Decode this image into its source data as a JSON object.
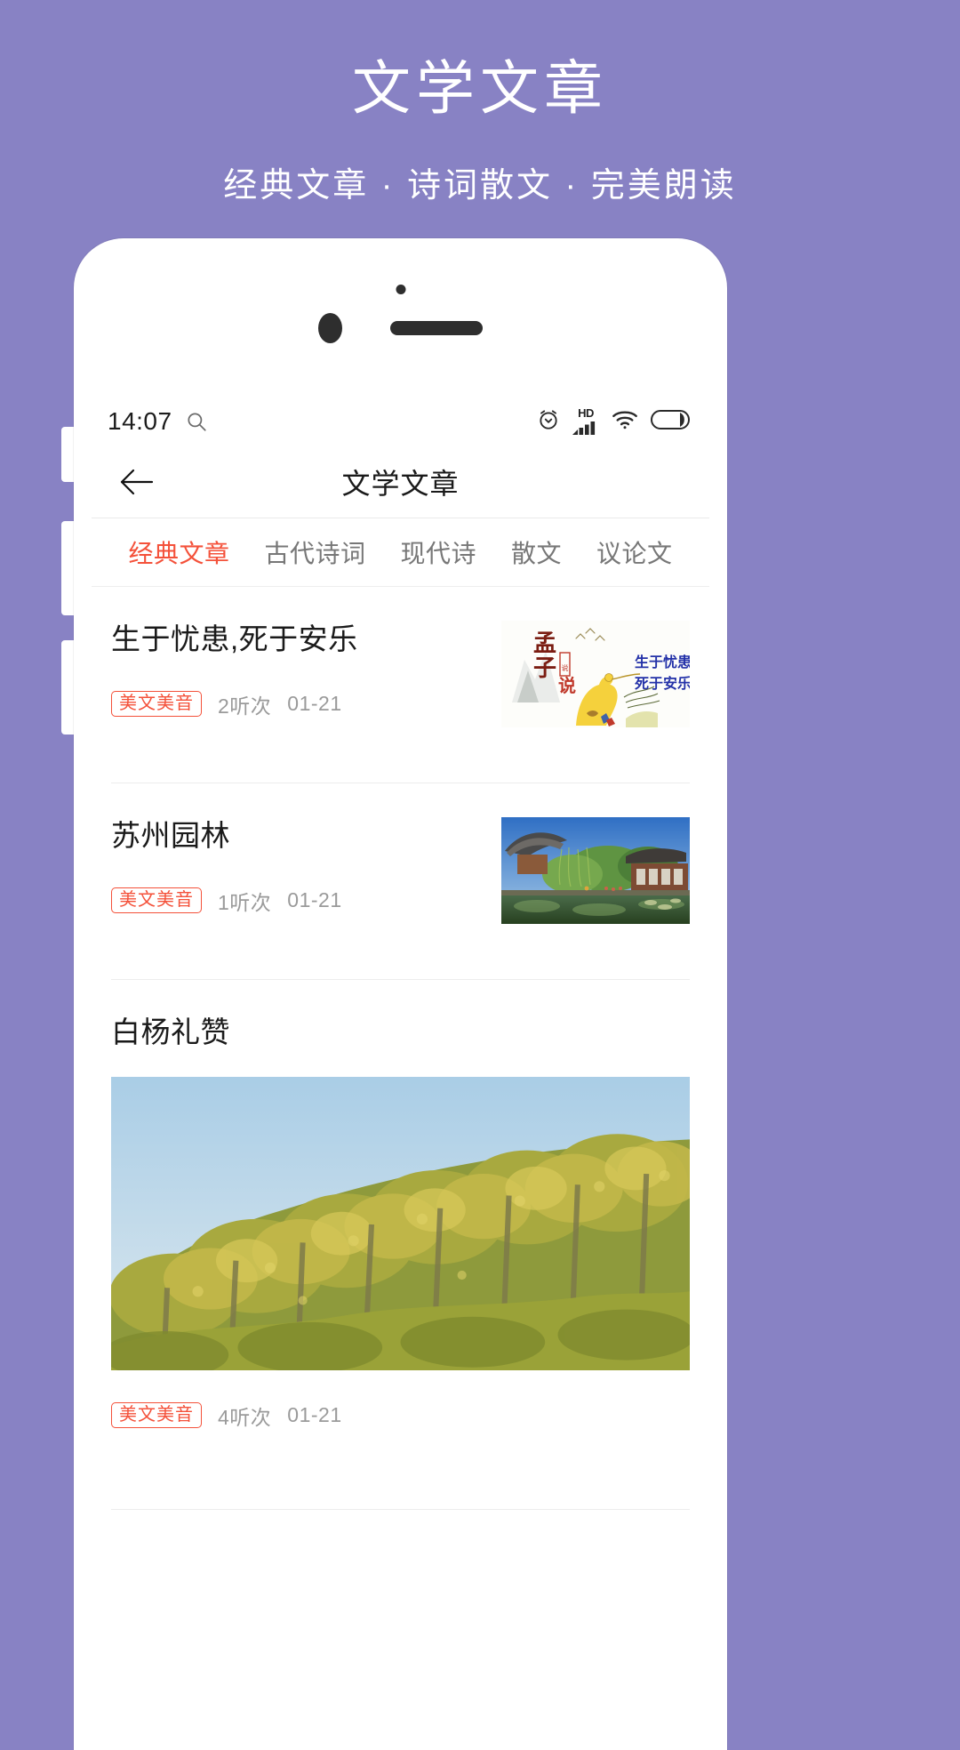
{
  "promo": {
    "title": "文学文章",
    "subtitle": "经典文章 · 诗词散文 · 完美朗读"
  },
  "statusbar": {
    "time": "14:07",
    "search_icon": "search-icon",
    "icons": [
      "alarm-icon",
      "hd-signal-icon",
      "wifi-icon",
      "battery-icon"
    ],
    "hd_label": "HD"
  },
  "navbar": {
    "back_icon": "back-arrow-icon",
    "title": "文学文章"
  },
  "tabs": [
    {
      "label": "经典文章",
      "active": true
    },
    {
      "label": "古代诗词",
      "active": false
    },
    {
      "label": "现代诗",
      "active": false
    },
    {
      "label": "散文",
      "active": false
    },
    {
      "label": "议论文",
      "active": false
    }
  ],
  "list": [
    {
      "title": "生于忧患,死于安乐",
      "badge": "美文美音",
      "plays": "2听次",
      "date": "01-21",
      "thumb": "mengzi-book-cover-image",
      "thumb_text_main": "孟子",
      "thumb_text_sub": "说",
      "thumb_text_right_1": "生于忧患",
      "thumb_text_right_2": "死于安乐",
      "layout": "small-thumb"
    },
    {
      "title": "苏州园林",
      "badge": "美文美音",
      "plays": "1听次",
      "date": "01-21",
      "thumb": "suzhou-garden-photo",
      "layout": "small-thumb"
    },
    {
      "title": "白杨礼赞",
      "badge": "美文美音",
      "plays": "4听次",
      "date": "01-21",
      "thumb": "poplar-trees-photo",
      "layout": "wide-thumb"
    }
  ],
  "colors": {
    "brand_background": "#8882c4",
    "accent_red": "#f4513a",
    "text_primary": "#1a1a1a",
    "text_muted": "#9a9a9a",
    "tab_inactive": "#777777"
  }
}
